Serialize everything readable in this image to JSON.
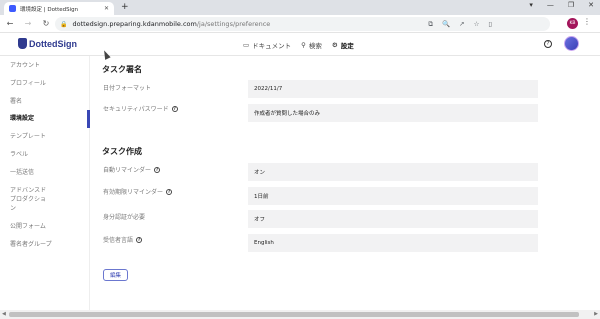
{
  "browser": {
    "tab_title": "環境設定 | DottedSign",
    "tab_close": "✕",
    "new_tab": "+",
    "window_controls": [
      "▾",
      "—",
      "❐",
      "✕"
    ],
    "back": "←",
    "forward": "→",
    "reload": "↻",
    "url_host": "dottedsign.preparing.kdanmobile.com",
    "url_path": "/ja/settings/preference",
    "toolbar_icons": [
      "⧉",
      "🔍",
      "↗",
      "☆",
      "▯"
    ],
    "profile_initials": "KB",
    "menu": "⋮"
  },
  "header": {
    "logo_text": "DottedSign",
    "nav": [
      {
        "icon": "▭",
        "label": "ドキュメント"
      },
      {
        "icon": "⚲",
        "label": "検索"
      },
      {
        "icon": "⚙",
        "label": "設定"
      }
    ],
    "help_icon": "?",
    "avatar": "●"
  },
  "sidebar": {
    "items": [
      {
        "label": "アカウント"
      },
      {
        "label": "プロフィール"
      },
      {
        "label": "署名"
      },
      {
        "label": "環境設定"
      },
      {
        "label": "テンプレート"
      },
      {
        "label": "ラベル"
      },
      {
        "label": "一括送信"
      },
      {
        "label": "アドバンスド"
      },
      {
        "label": "プロダクショ"
      },
      {
        "label": "ン"
      },
      {
        "label": "公開フォーム"
      },
      {
        "label": "署名者グループ"
      }
    ]
  },
  "main": {
    "section1_title": "タスク署名",
    "section2_title": "タスク作成",
    "rows": [
      {
        "label": "日付フォーマット",
        "value": "2022/11/7"
      },
      {
        "label": "セキュリティパスワード",
        "value": "作成者が質問した場合のみ"
      },
      {
        "label": "自動リマインダー",
        "value": "オン"
      },
      {
        "label": "有効期限リマインダー",
        "value": "1日前"
      },
      {
        "label": "身分認証が必要",
        "value": "オフ"
      },
      {
        "label": "受信者言語",
        "value": "English"
      }
    ],
    "question_icon": "?",
    "edit_label": "編集"
  },
  "scrollbar": {
    "left": "◀",
    "right": "▶"
  },
  "colors": {
    "accent": "#3947b5",
    "value_bg": "#f2f2f3",
    "profile": "#a3155b"
  }
}
